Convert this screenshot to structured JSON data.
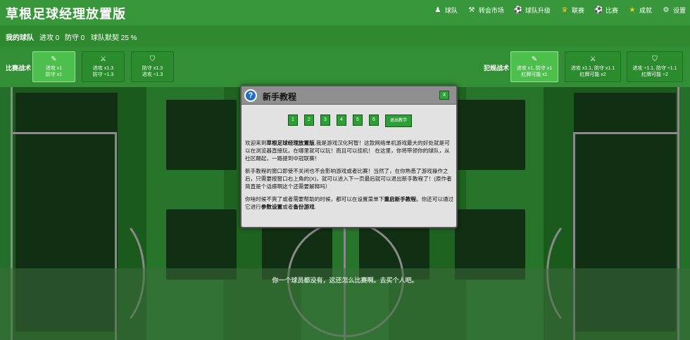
{
  "app": {
    "title": "草根足球经理放置版"
  },
  "nav": [
    {
      "label": "球队",
      "icon": "coach-icon"
    },
    {
      "label": "转会市场",
      "icon": "player-icon"
    },
    {
      "label": "球队升级",
      "icon": "ball-icon"
    },
    {
      "label": "联赛",
      "icon": "trophy-icon"
    },
    {
      "label": "比赛",
      "icon": "soccer-ball-icon"
    },
    {
      "label": "成就",
      "icon": "star-icon"
    },
    {
      "label": "设置",
      "icon": "gear-icon"
    }
  ],
  "info": {
    "team_label": "我的球队",
    "attack": "进攻 0",
    "defense": "防守 0",
    "chemistry": "球队默契 25 %"
  },
  "tactics": {
    "match_label": "比赛战术",
    "match": [
      {
        "l1": "进攻 x1",
        "l2": "防守 x1",
        "icon": "boot-icon"
      },
      {
        "l1": "进攻 x1.3",
        "l2": "防守 ÷1.3",
        "icon": "sword-icon"
      },
      {
        "l1": "防守 x1.3",
        "l2": "进攻 ÷1.3",
        "icon": "shield-icon"
      }
    ],
    "foul_label": "犯规战术",
    "foul": [
      {
        "l1": "进攻 x1, 防守 x1",
        "l2": "红牌可能 x1",
        "icon": "boot-icon"
      },
      {
        "l1": "进攻 x1.1, 防守 x1.1",
        "l2": "红牌可能 x2",
        "icon": "sword-icon"
      },
      {
        "l1": "进攻 ÷1.1, 防守 ÷1.1",
        "l2": "红牌可能 ÷2",
        "icon": "shield-icon"
      }
    ]
  },
  "pitch": {
    "message": "你一个球员都没有，这还怎么比赛啊。去买个人吧。"
  },
  "modal": {
    "title": "新手教程",
    "close": "X",
    "pages": [
      "1",
      "2",
      "3",
      "4",
      "5",
      "6"
    ],
    "exit": "退出教学",
    "p1_a": "欢迎来到",
    "p1_b": "草根足球经理放置版",
    "p1_c": ",我是游戏汉化阿智！这款网络单机游戏最大的好处就是可以在浏览器直接玩，在哪里就可以玩！而且可以挂机！ 在这里，你将带领你的球队，从社区踢起，一路提到中冠联赛！",
    "p2": "新手教程的窗口即使不关闭也不会影响游戏或者比赛！当然了，在你熟悉了游戏操作之后，只需要按窗口右上角的(X)，就可以进入下一页最后就可以退出新手教程了！(原作者简直是个话痨啊这个还需要解释吗）",
    "p3_a": "你啥时候不爽了或者需要帮助的时候，都可以在设置菜单下",
    "p3_b": "重启新手教程",
    "p3_c": "。你还可以通过它进行",
    "p3_d": "参数设置",
    "p3_e": "或者",
    "p3_f": "备份游戏",
    "p3_g": "."
  }
}
